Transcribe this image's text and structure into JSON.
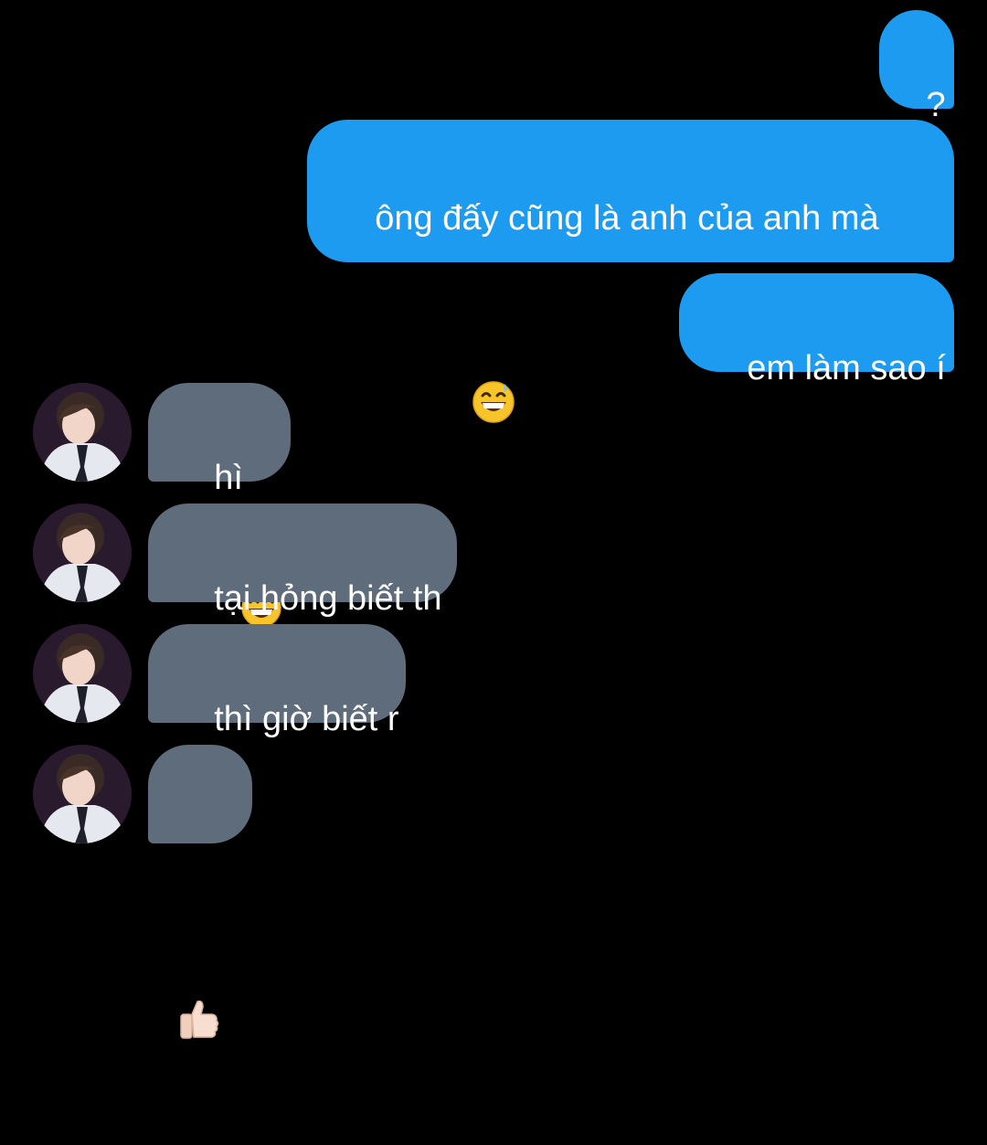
{
  "conversation": {
    "sent": [
      {
        "text": "?"
      },
      {
        "text": "ông đấy cũng là anh của anh mà",
        "emoji": "grinning-face-with-sweat"
      },
      {
        "text": "em làm sao í"
      }
    ],
    "received": [
      {
        "text": "hì",
        "emoji": "beaming-face-with-smiling-eyes"
      },
      {
        "text": "tại hỏng biết th"
      },
      {
        "text": "thì giờ biết r"
      },
      {
        "text": "",
        "emoji": "thumbs-up-light-skin-tone"
      }
    ]
  },
  "colors": {
    "background": "#000000",
    "sent_bubble": "#1d9bf0",
    "received_bubble": "#5f6c7b",
    "text": "#ffffff"
  }
}
